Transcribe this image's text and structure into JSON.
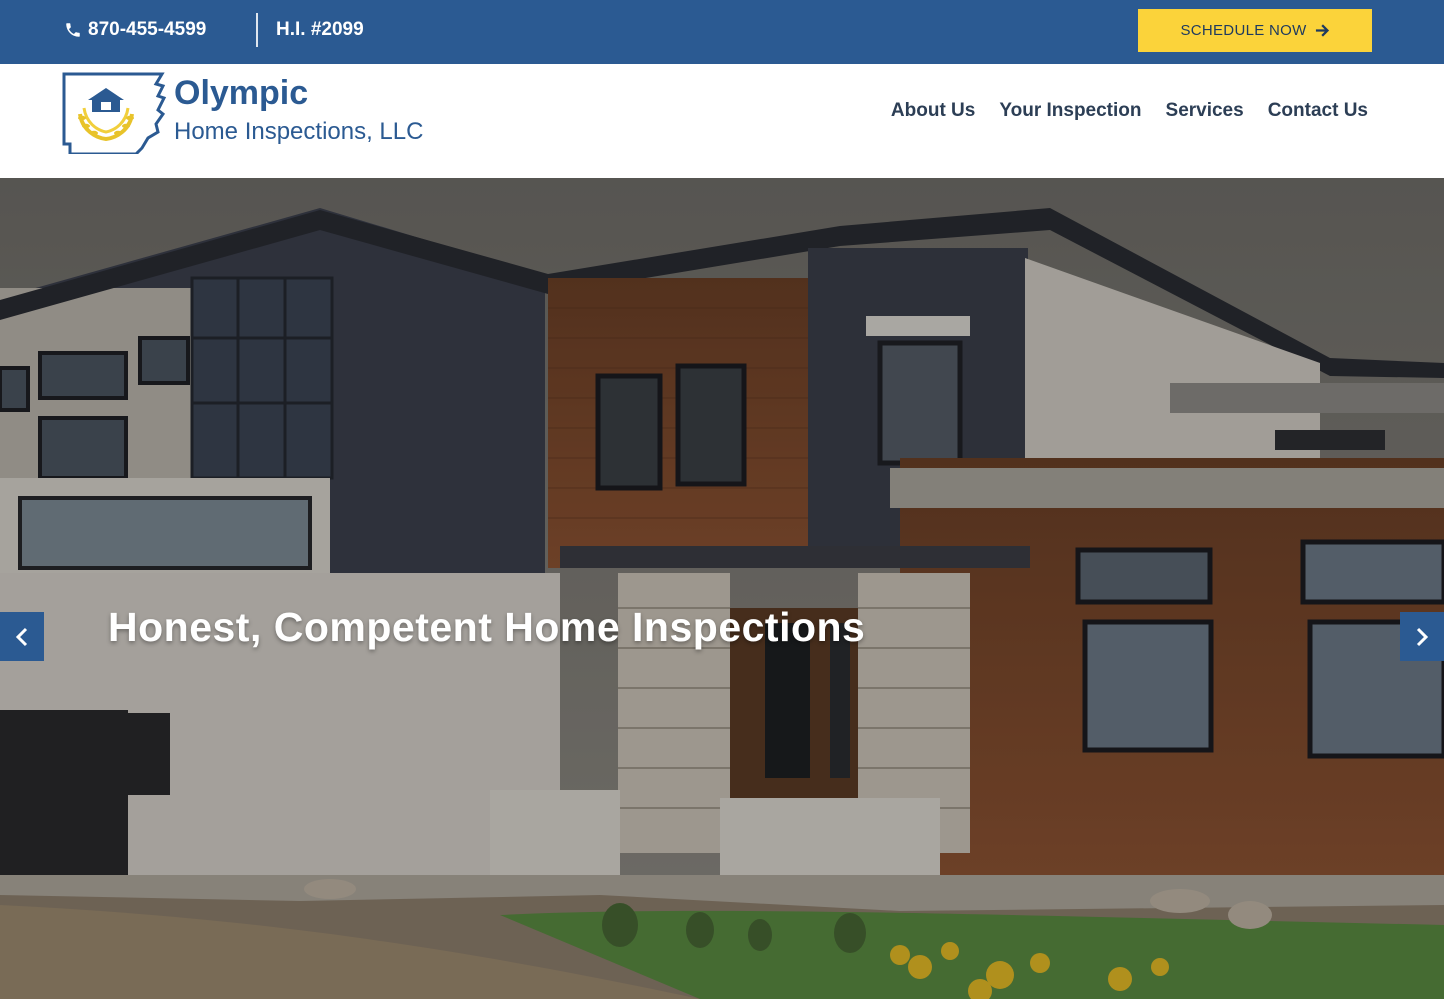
{
  "topbar": {
    "phone": "870-455-4599",
    "license": "H.I. #2099",
    "schedule_label": "SCHEDULE NOW",
    "icons": {
      "phone": "phone-icon",
      "schedule": "arrow-right-icon"
    }
  },
  "header": {
    "brand_name": "Olympic",
    "brand_sub": "Home Inspections, LLC",
    "nav": [
      {
        "label": "About Us"
      },
      {
        "label": "Your Inspection"
      },
      {
        "label": "Services"
      },
      {
        "label": "Contact Us"
      }
    ]
  },
  "hero": {
    "title": "Honest, Competent Home Inspections",
    "prev_icon": "chevron-left-icon",
    "next_icon": "chevron-right-icon"
  },
  "colors": {
    "primary": "#2b5a92",
    "accent": "#fbd33a",
    "nav_text": "#2c3e55",
    "white": "#ffffff"
  }
}
